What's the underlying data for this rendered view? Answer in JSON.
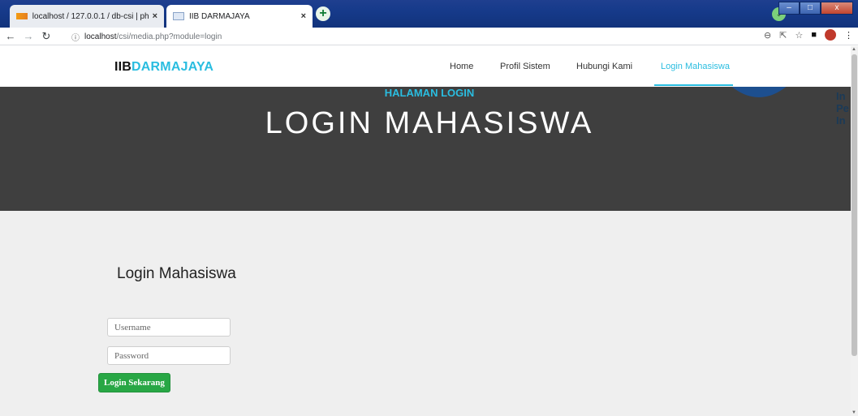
{
  "browser": {
    "tabs": [
      {
        "title": "localhost / 127.0.0.1 / db-csi | ph",
        "close": "×"
      },
      {
        "title": "IIB DARMAJAYA",
        "close": "×"
      }
    ],
    "new_tab": "+",
    "window_buttons": {
      "minimize": "–",
      "maximize": "□",
      "close": "x"
    },
    "address": {
      "host": "localhost",
      "path": "/csi/media.php?module=login"
    }
  },
  "site": {
    "brand_part1": "IIB",
    "brand_part2": "DARMAJAYA",
    "menu": [
      "Home",
      "Profil Sistem",
      "Hubungi Kami",
      "Login Mahasiswa"
    ],
    "active_menu": "Login Mahasiswa"
  },
  "hero": {
    "subtitle": "HALAMAN LOGIN",
    "title": "LOGIN MAHASISWA",
    "logo_text": [
      "In",
      "Pe",
      "In"
    ]
  },
  "login": {
    "heading": "Login Mahasiswa",
    "username_placeholder": "Username",
    "password_placeholder": "Password",
    "submit_label": "Login Sekarang"
  },
  "colors": {
    "accent": "#2abde0",
    "hero_bg": "#3f3f3f",
    "button_green": "#28a745"
  }
}
